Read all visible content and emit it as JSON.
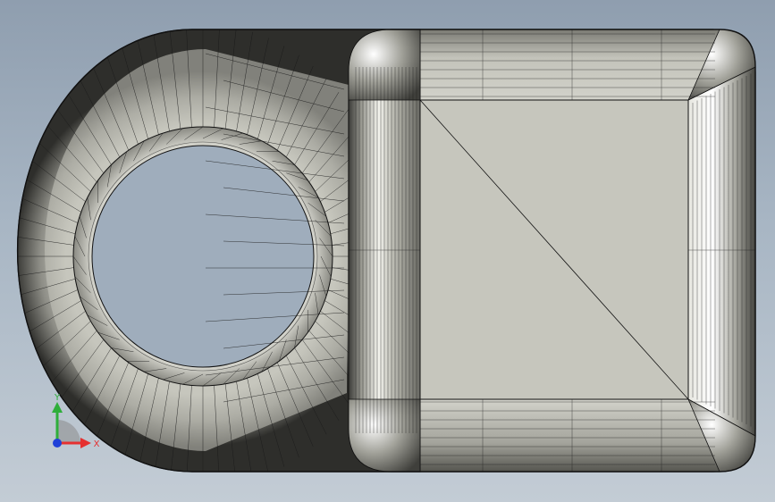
{
  "viewport": {
    "background_top": "#8f9eaf",
    "background_bottom": "#c3ccd5"
  },
  "model": {
    "face_color": "#c6c6bd",
    "edge_color": "#111111",
    "highlight_color": "#ffffff"
  },
  "triad": {
    "x_label": "X",
    "y_label": "Y",
    "x_color": "#e53030",
    "y_color": "#2eae3a",
    "z_color": "#2040d8"
  }
}
